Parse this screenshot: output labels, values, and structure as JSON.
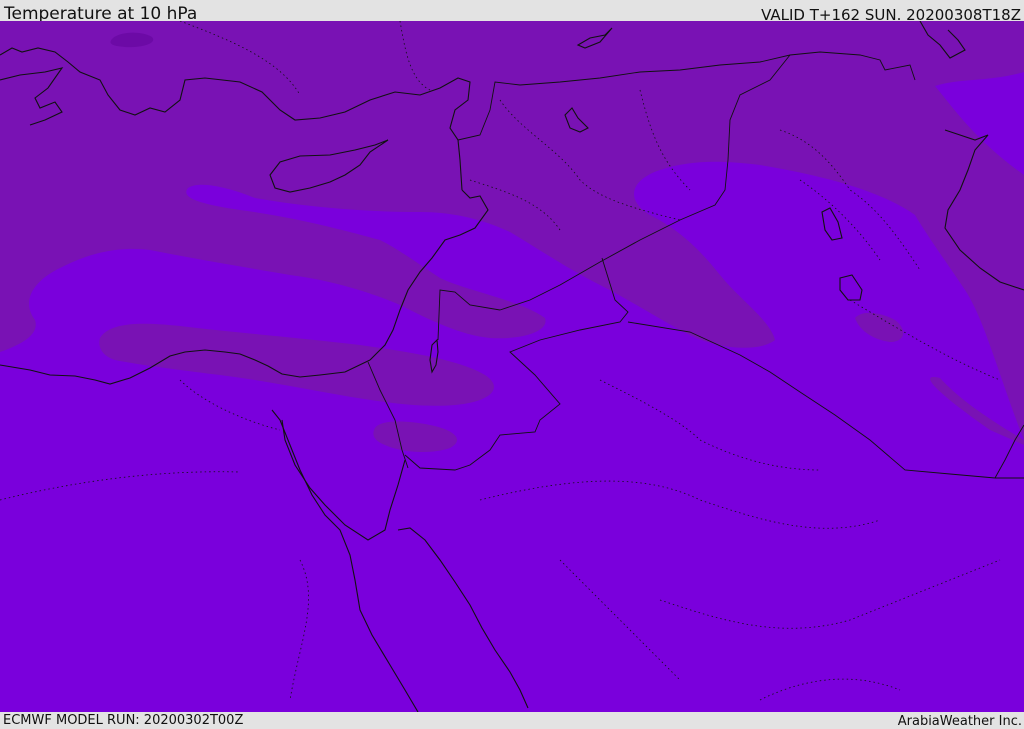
{
  "header": {
    "title": "Temperature at 10 hPa",
    "valid": "VALID T+162 SUN. 20200308T18Z"
  },
  "footer": {
    "model_run": "ECMWF MODEL RUN: 20200302T00Z",
    "credit": "ArabiaWeather Inc."
  },
  "map": {
    "colors": {
      "base_field": "#7a00dc",
      "warmer_band": "#7912b4",
      "warmest_spot": "#6c0aa6",
      "coastline": "#111111",
      "border": "#111111"
    }
  }
}
